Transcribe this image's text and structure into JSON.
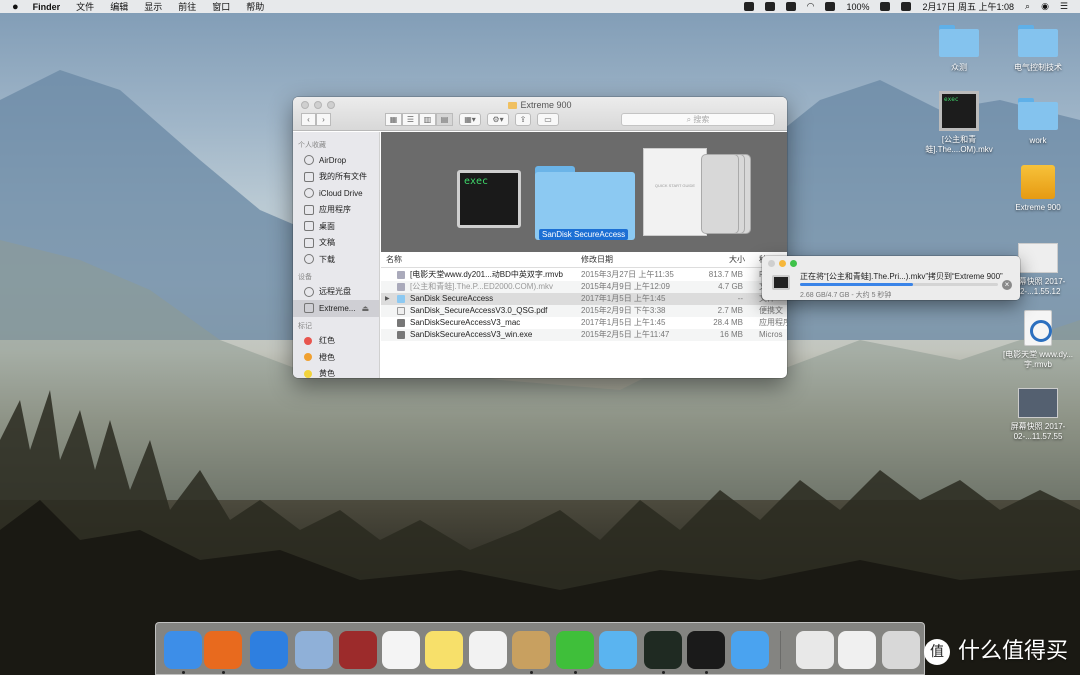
{
  "menubar": {
    "apple": "",
    "app": "Finder",
    "items": [
      "文件",
      "编辑",
      "显示",
      "前往",
      "窗口",
      "帮助"
    ],
    "battery": "100%",
    "datetime": "2月17日 周五 上午1:08"
  },
  "finder": {
    "title": "Extreme 900",
    "search_placeholder": "搜索",
    "sidebar": {
      "favorites_header": "个人收藏",
      "favorites": [
        {
          "label": "AirDrop",
          "icon": "airdrop-icon"
        },
        {
          "label": "我的所有文件",
          "icon": "all-files-icon"
        },
        {
          "label": "iCloud Drive",
          "icon": "cloud-icon"
        },
        {
          "label": "应用程序",
          "icon": "applications-icon"
        },
        {
          "label": "桌面",
          "icon": "desktop-icon"
        },
        {
          "label": "文稿",
          "icon": "documents-icon"
        },
        {
          "label": "下载",
          "icon": "downloads-icon"
        }
      ],
      "devices_header": "设备",
      "devices": [
        {
          "label": "远程光盘",
          "icon": "remote-disc-icon"
        },
        {
          "label": "Extreme...",
          "icon": "drive-icon"
        }
      ],
      "tags_header": "标记",
      "tags": [
        {
          "label": "红色",
          "color": "#e8554e"
        },
        {
          "label": "橙色",
          "color": "#f0a030"
        },
        {
          "label": "黄色",
          "color": "#f2d33a"
        }
      ]
    },
    "preview": {
      "exec_label": "exec",
      "folder_label": "SanDisk SecureAccess",
      "doc_text": "QUICK START GUIDE"
    },
    "columns": {
      "name": "名称",
      "date": "修改日期",
      "size": "大小",
      "kind": "种"
    },
    "rows": [
      {
        "name": "[电影天堂www.dy201...动BD中英双字.rmvb",
        "date": "2015年3月27日 上午11:35",
        "size": "813.7 MB",
        "kind": "R"
      },
      {
        "name": "[公主和青蛙].The.P...ED2000.COM).mkv",
        "date": "2015年4月9日 上午12:09",
        "size": "4.7 GB",
        "kind": "文"
      },
      {
        "name": "SanDisk SecureAccess",
        "date": "2017年1月5日 上午1:45",
        "size": "--",
        "kind": "文件"
      },
      {
        "name": "SanDisk_SecureAccessV3.0_QSG.pdf",
        "date": "2015年2月9日 下午3:38",
        "size": "2.7 MB",
        "kind": "便携文"
      },
      {
        "name": "SanDiskSecureAccessV3_mac",
        "date": "2017年1月5日 上午1:45",
        "size": "28.4 MB",
        "kind": "应用程序"
      },
      {
        "name": "SanDiskSecureAccessV3_win.exe",
        "date": "2015年2月5日 上午11:47",
        "size": "16 MB",
        "kind": "Micros"
      }
    ]
  },
  "copy_dialog": {
    "message": "正在将“[公主和青蛙].The.Pri...).mkv”拷贝到“Extreme 900”",
    "detail": "2.68 GB/4.7 GB - 大约 5 秒钟",
    "progress": 0.57
  },
  "desktop_icons": [
    {
      "label": "众测",
      "kind": "folder"
    },
    {
      "label": "电气控制技术",
      "kind": "folder"
    },
    {
      "label": "[公主和青蛙].The....OM).mkv",
      "kind": "video"
    },
    {
      "label": "work",
      "kind": "folder"
    },
    {
      "label": "Extreme 900",
      "kind": "drive"
    },
    {
      "label": "屏幕快照 2017-02-...1.55.12",
      "kind": "screenshot"
    },
    {
      "label": "[电影天堂 www.dy...字.rmvb",
      "kind": "quicktime"
    },
    {
      "label": "屏幕快照 2017-02-...11.57.55",
      "kind": "screenshot"
    }
  ],
  "dock": [
    {
      "name": "finder",
      "color": "#3d8ee8"
    },
    {
      "name": "firefox",
      "color": "#e86a1e"
    },
    {
      "name": "safari",
      "color": "#2e7fe0"
    },
    {
      "name": "mail",
      "color": "#8fb0d8"
    },
    {
      "name": "dictionary",
      "color": "#9c2b2b"
    },
    {
      "name": "calendar",
      "color": "#f4f4f4"
    },
    {
      "name": "notes",
      "color": "#f7e06a"
    },
    {
      "name": "photos",
      "color": "#f2f2f2"
    },
    {
      "name": "speaker",
      "color": "#c8a060"
    },
    {
      "name": "wechat",
      "color": "#3fbf3a"
    },
    {
      "name": "qq-bubble",
      "color": "#5ab4f0"
    },
    {
      "name": "activity-monitor",
      "color": "#1f2a22"
    },
    {
      "name": "qq",
      "color": "#1a1a1a"
    },
    {
      "name": "messages",
      "color": "#4aa3f0"
    },
    {
      "name": "sequel",
      "color": "#e8e8e8"
    },
    {
      "name": "preview-docs",
      "color": "#f0f0f0"
    },
    {
      "name": "trash",
      "color": "#d8d8d8"
    }
  ],
  "watermark": {
    "badge": "值",
    "text": "什么值得买"
  }
}
